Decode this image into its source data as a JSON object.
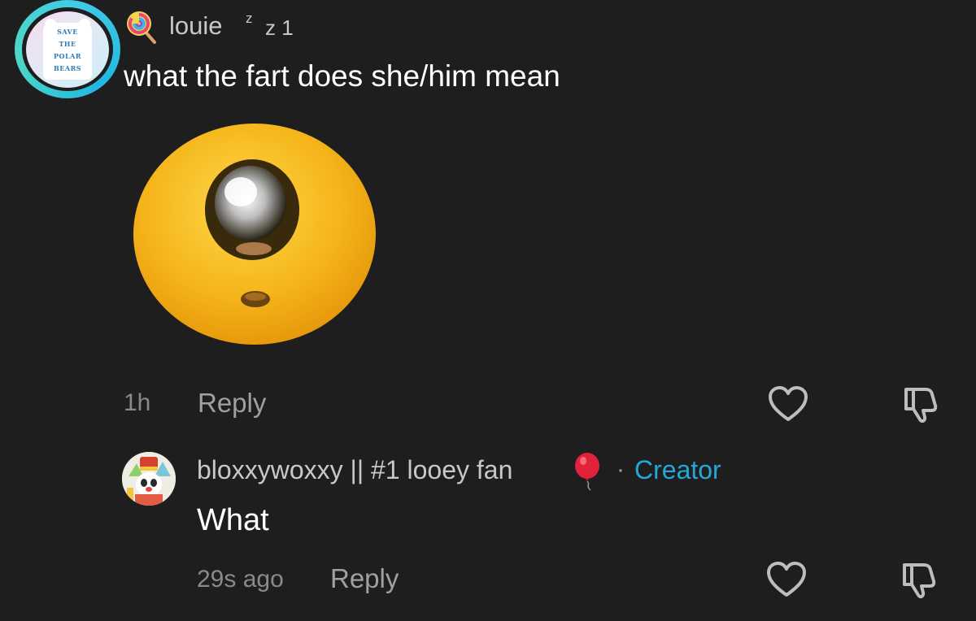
{
  "comment": {
    "avatar_text": [
      "SAVE",
      "THE",
      "POLAR",
      "BEARS"
    ],
    "avatar_ring_color": "#3ec9e6",
    "name_emoji": "lollipop-icon",
    "username": "louie",
    "username_small": "z",
    "username_suffix": "z 1",
    "text": "what the fart does she/him mean",
    "sticker": "shocked-emoji-face-sticker",
    "time": "1h",
    "reply_label": "Reply"
  },
  "reply": {
    "avatar": "clown-character-avatar",
    "username": "bloxxywoxxy || #1 looey fan",
    "name_emoji": "balloon-icon",
    "separator": "·",
    "badge": "Creator",
    "badge_color": "#23a8d8",
    "text": "What",
    "time": "29s ago",
    "reply_label": "Reply"
  },
  "colors": {
    "background": "#1e1e1e",
    "text": "#ffffff",
    "muted": "#a0a0a0"
  }
}
